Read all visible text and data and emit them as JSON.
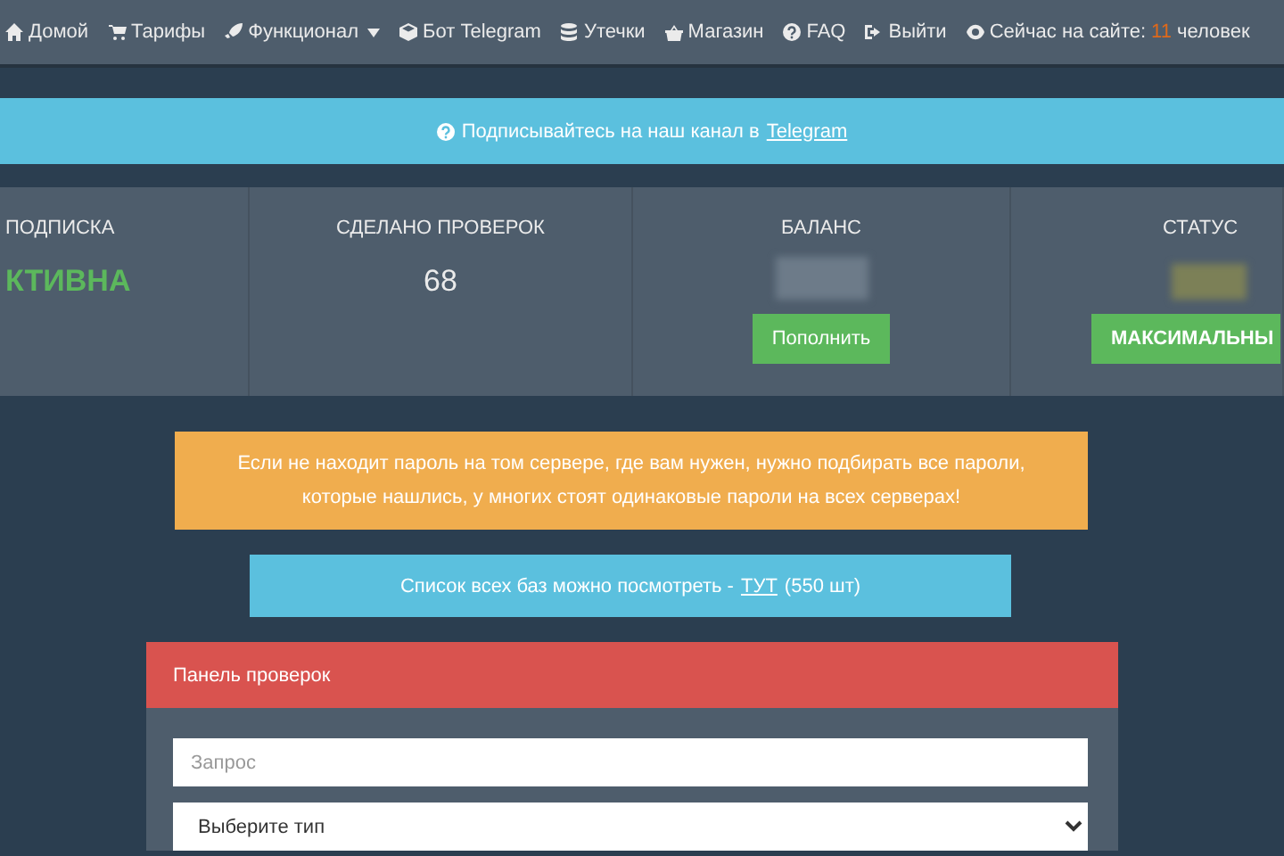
{
  "nav": {
    "items": [
      {
        "label": "Домой",
        "dropdown": false
      },
      {
        "label": "Тарифы",
        "dropdown": false
      },
      {
        "label": "Функционал",
        "dropdown": true
      },
      {
        "label": "Бот Telegram",
        "dropdown": false
      },
      {
        "label": "Утечки",
        "dropdown": false
      },
      {
        "label": "Магазин",
        "dropdown": false
      },
      {
        "label": "FAQ",
        "dropdown": false
      },
      {
        "label": "Выйти",
        "dropdown": false
      }
    ],
    "online": {
      "label": "Сейчас на сайте:",
      "count": "11",
      "unit": "человек"
    }
  },
  "banner": {
    "text": "Подписывайтесь на наш канал в",
    "link": "Telegram"
  },
  "stats": [
    {
      "title": "ПОДПИСКА",
      "value": "КТИВНА",
      "kind": "status"
    },
    {
      "title": "СДЕЛАНО ПРОВЕРОК",
      "value": "68",
      "kind": "number"
    },
    {
      "title": "БАЛАНС",
      "kind": "hidden",
      "button": "Пополнить",
      "color": "#6d7b89"
    },
    {
      "title": "СТАТУС",
      "kind": "hidden",
      "button": "МАКСИМАЛЬНЫ",
      "color": "#7c8057"
    }
  ],
  "warning": "Если не находит пароль на том сервере, где вам нужен, нужно подбирать все пароли, которые нашлись, у многих стоят одинаковые пароли на всех серверах!",
  "bases": {
    "text": "Список всех баз можно посмотреть -",
    "link": "ТУТ",
    "count": "(550 шт)"
  },
  "panel": {
    "title": "Панель проверок",
    "query": {
      "placeholder": "Запрос"
    },
    "type_select": {
      "value": "Выберите тип"
    }
  }
}
